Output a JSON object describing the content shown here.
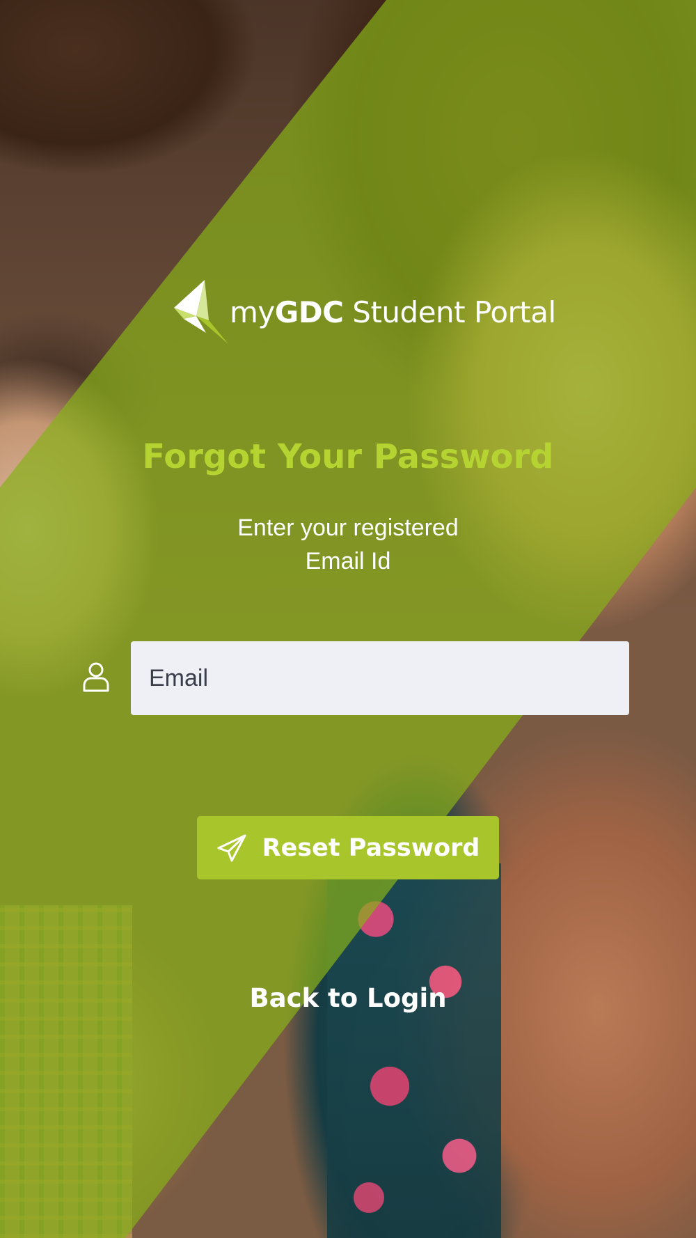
{
  "brand": {
    "prefix": "my",
    "name": "GDC",
    "suffix": " Student Portal"
  },
  "title": "Forgot Your Password",
  "subtitle": "Enter your registered Email Id",
  "email": {
    "placeholder": "Email",
    "value": ""
  },
  "reset_button": {
    "label": "Reset Password",
    "icon": "paper-plane-icon"
  },
  "back_link": "Back to Login",
  "colors": {
    "accent": "#a8c62b",
    "title": "#b5d331",
    "overlay": "#88b018"
  }
}
